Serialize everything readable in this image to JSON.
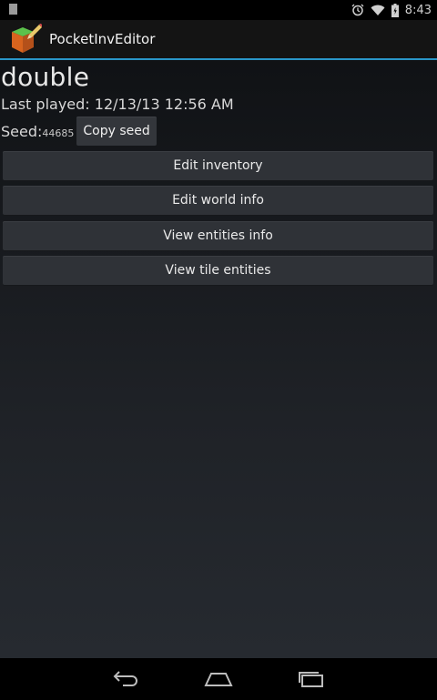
{
  "status_bar": {
    "time": "8:43",
    "icons": [
      "notification-icon",
      "alarm-icon",
      "wifi-icon",
      "battery-icon"
    ]
  },
  "action_bar": {
    "title": "PocketInvEditor",
    "accent_color": "#2a96c8"
  },
  "world": {
    "name": "double",
    "last_played": "Last played: 12/13/13 12:56 AM",
    "seed_label": "Seed:",
    "seed_value": "44685"
  },
  "buttons": {
    "copy_seed": "Copy seed",
    "edit_inventory": "Edit inventory",
    "edit_world_info": "Edit world info",
    "view_entities_info": "View entities info",
    "view_tile_entities": "View tile entities"
  },
  "nav_bar": {
    "icons": [
      "back-icon",
      "home-icon",
      "recent-apps-icon"
    ]
  }
}
